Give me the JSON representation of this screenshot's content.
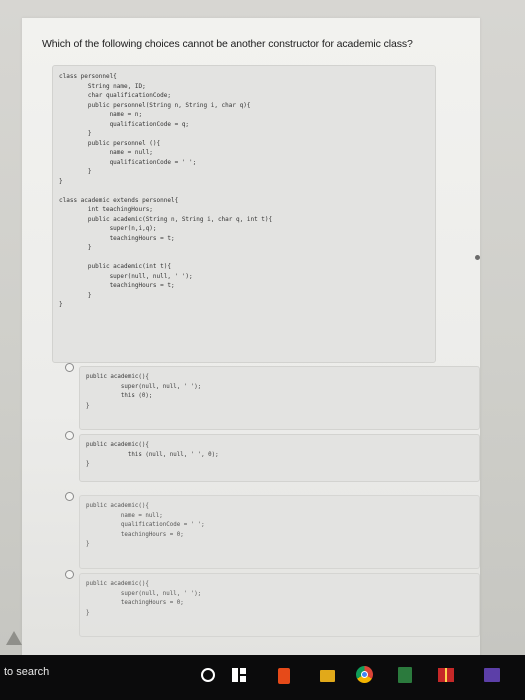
{
  "question": "Which of the following choices cannot be another constructor for academic class?",
  "code": "class personnel{\n        String name, ID;\n        char qualificationCode;\n        public personnel(String n, String i, char q){\n              name = n;\n              qualificationCode = q;\n        }\n        public personnel (){\n              name = null;\n              qualificationCode = ' ';\n        }\n}\n\nclass academic extends personnel{\n        int teachingHours;\n        public academic(String n, String i, char q, int t){\n              super(n,i,q);\n              teachingHours = t;\n        }\n\n        public academic(int t){\n              super(null, null, ' ');\n              teachingHours = t;\n        }\n}",
  "options": [
    {
      "code": "public academic(){\n          super(null, null, ' ');\n          this (0);\n}"
    },
    {
      "code": "public academic(){\n            this (null, null, ' ', 0);\n}"
    },
    {
      "code": "public academic(){\n          name = null;\n          qualificationCode = ' ';\n          teachingHours = 0;\n}"
    },
    {
      "code": "public academic(){\n          super(null, null, ' ');\n          teachingHours = 0;\n}"
    }
  ],
  "taskbar": {
    "search_label": "to search",
    "icons": [
      "cortana-icon",
      "task-view-icon",
      "office-icon",
      "file-explorer-icon",
      "chrome-icon",
      "calculator-icon",
      "gift-icon",
      "app-icon"
    ]
  }
}
